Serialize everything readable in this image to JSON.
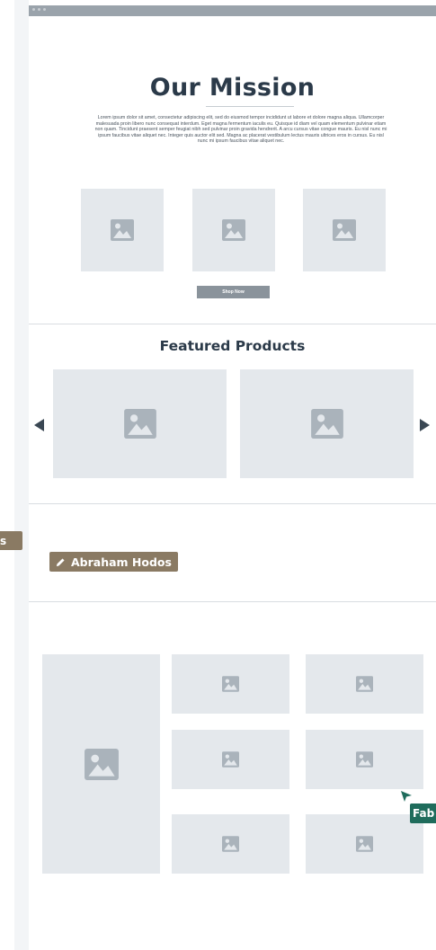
{
  "mission": {
    "title": "Our Mission",
    "body": "Lorem ipsum dolor sit amet, consectetur adipiscing elit, sed do eiusmod tempor incididunt ut labore et dolore magna aliqua. Ullamcorper malesuada proin libero nunc consequat interdum. Eget magna fermentum iaculis eu. Quisque id diam vel quam elementum pulvinar etiam non quam. Tincidunt praesent semper feugiat nibh sed pulvinar proin gravida hendrerit. A arcu cursus vitae congue mauris. Eu nisl nunc mi ipsum faucibus vitae aliquet nec. Integer quis auctor elit sed. Magna ac placerat vestibulum lectus mauris ultrices eros in cursus. Eu nisl nunc mi ipsum faucibus vitae aliquet nec.",
    "button_label": "Shop Now"
  },
  "featured": {
    "title": "Featured Products"
  },
  "collaborators": {
    "editor_name": "Abraham Hodos",
    "left_tag": "s",
    "right_tag": "Fab"
  },
  "icons": {
    "image": "image-placeholder-icon",
    "pencil": "pencil-icon",
    "prev": "chevron-left-icon",
    "next": "chevron-right-icon",
    "cursor": "cursor-arrow-icon"
  },
  "colors": {
    "heading": "#2b3a49",
    "placeholder": "#e4e8ec",
    "button": "#8a939b",
    "editor_tag": "#8a7a63",
    "collaborator_tag": "#1f6c5c"
  }
}
